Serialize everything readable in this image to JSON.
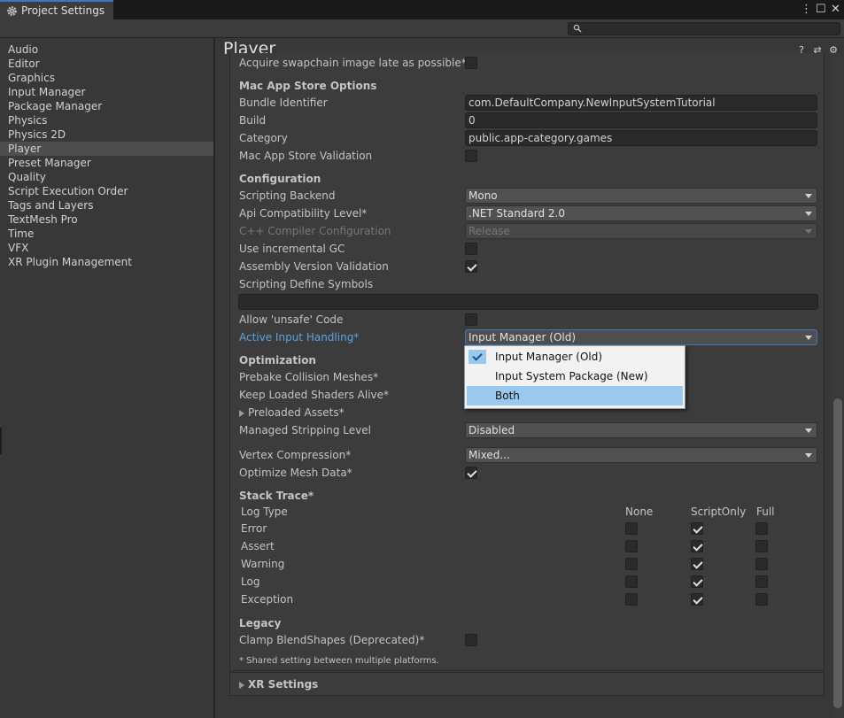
{
  "window": {
    "tab_title": "Project Settings",
    "bg_text": "**** *** *"
  },
  "sidebar": {
    "items": [
      {
        "label": "Audio"
      },
      {
        "label": "Editor"
      },
      {
        "label": "Graphics"
      },
      {
        "label": "Input Manager"
      },
      {
        "label": "Package Manager"
      },
      {
        "label": "Physics"
      },
      {
        "label": "Physics 2D"
      },
      {
        "label": "Player"
      },
      {
        "label": "Preset Manager"
      },
      {
        "label": "Quality"
      },
      {
        "label": "Script Execution Order"
      },
      {
        "label": "Tags and Layers"
      },
      {
        "label": "TextMesh Pro"
      },
      {
        "label": "Time"
      },
      {
        "label": "VFX"
      },
      {
        "label": "XR Plugin Management"
      }
    ],
    "selected": "Player"
  },
  "main": {
    "title": "Player",
    "rows": {
      "acquire": "Acquire swapchain image late as possible*",
      "mac_header": "Mac App Store Options",
      "bundle_label": "Bundle Identifier",
      "bundle_value": "com.DefaultCompany.NewInputSystemTutorial",
      "build_label": "Build",
      "build_value": "0",
      "category_label": "Category",
      "category_value": "public.app-category.games",
      "validation_label": "Mac App Store Validation",
      "config_header": "Configuration",
      "backend_label": "Scripting Backend",
      "backend_value": "Mono",
      "api_label": "Api Compatibility Level*",
      "api_value": ".NET Standard 2.0",
      "cpp_label": "C++ Compiler Configuration",
      "cpp_value": "Release",
      "gc_label": "Use incremental GC",
      "assembly_label": "Assembly Version Validation",
      "define_label": "Scripting Define Symbols",
      "unsafe_label": "Allow 'unsafe' Code",
      "input_label": "Active Input Handling*",
      "input_value": "Input Manager (Old)",
      "opt_header": "Optimization",
      "prebake_label": "Prebake Collision Meshes*",
      "shaders_label": "Keep Loaded Shaders Alive*",
      "preloaded_label": "Preloaded Assets*",
      "stripping_label": "Managed Stripping Level",
      "stripping_value": "Disabled",
      "vertex_label": "Vertex Compression*",
      "vertex_value": "Mixed...",
      "mesh_label": "Optimize Mesh Data*",
      "stack_header": "Stack Trace*",
      "log_type": "Log Type",
      "col_none": "None",
      "col_script": "ScriptOnly",
      "col_full": "Full",
      "legacy_header": "Legacy",
      "clamp_label": "Clamp BlendShapes (Deprecated)*",
      "footnote": "* Shared setting between multiple platforms.",
      "xr_label": "XR Settings"
    },
    "stack_rows": [
      {
        "label": "Error"
      },
      {
        "label": "Assert"
      },
      {
        "label": "Warning"
      },
      {
        "label": "Log"
      },
      {
        "label": "Exception"
      }
    ]
  },
  "popup": {
    "items": [
      {
        "label": "Input Manager (Old)",
        "checked": true
      },
      {
        "label": "Input System Package (New)",
        "checked": false
      },
      {
        "label": "Both",
        "highlighted": true
      }
    ]
  }
}
